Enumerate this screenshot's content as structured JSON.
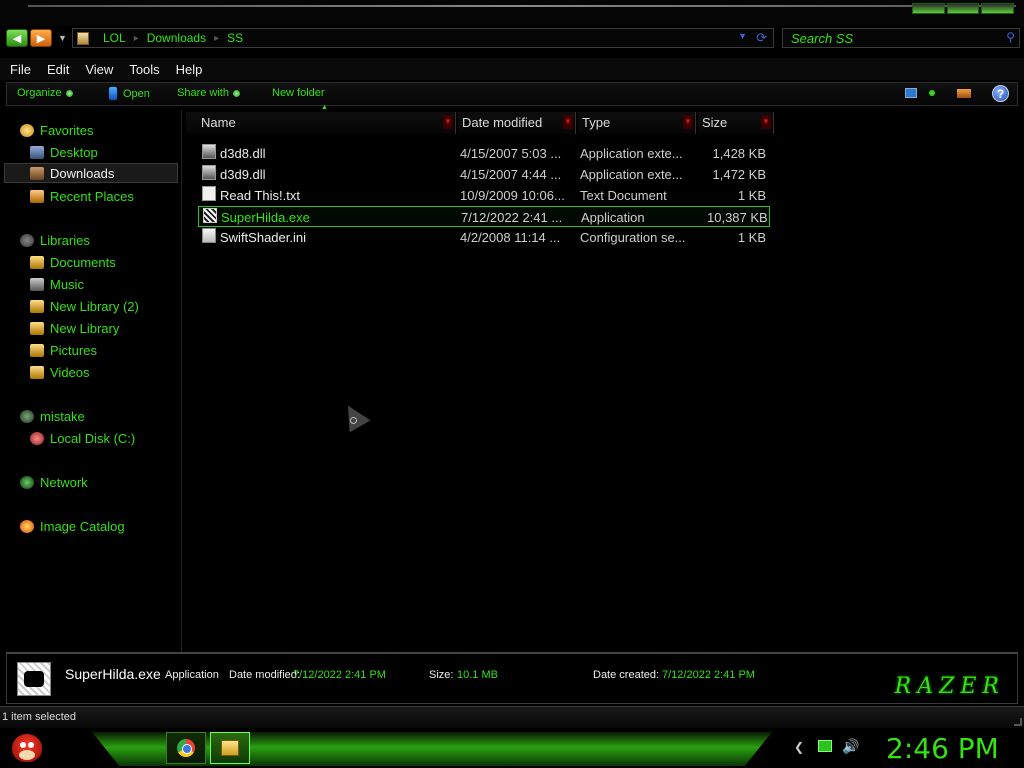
{
  "window": {
    "address_path": [
      "LOL",
      "Downloads",
      "SS"
    ],
    "search_placeholder": "Search SS"
  },
  "menu": [
    "File",
    "Edit",
    "View",
    "Tools",
    "Help"
  ],
  "command_bar": {
    "organize": "Organize",
    "open": "Open",
    "share_with": "Share with",
    "new_folder": "New folder"
  },
  "nav_pane": {
    "favorites": "Favorites",
    "desktop": "Desktop",
    "downloads": "Downloads",
    "recent_places": "Recent Places",
    "libraries": "Libraries",
    "documents": "Documents",
    "music": "Music",
    "new_library_2": "New Library (2)",
    "new_library": "New Library",
    "pictures": "Pictures",
    "videos": "Videos",
    "homegroup": "mistake",
    "local_disk": "Local Disk (C:)",
    "network": "Network",
    "image_catalog": "Image Catalog"
  },
  "columns": {
    "name": "Name",
    "date": "Date modified",
    "type": "Type",
    "size": "Size"
  },
  "files": [
    {
      "name": "d3d8.dll",
      "date": "4/15/2007 5:03 ...",
      "type": "Application exte...",
      "size": "1,428 KB"
    },
    {
      "name": "d3d9.dll",
      "date": "4/15/2007 4:44 ...",
      "type": "Application exte...",
      "size": "1,472 KB"
    },
    {
      "name": "Read This!.txt",
      "date": "10/9/2009 10:06...",
      "type": "Text Document",
      "size": "1 KB"
    },
    {
      "name": "SuperHilda.exe",
      "date": "7/12/2022 2:41 ...",
      "type": "Application",
      "size": "10,387 KB"
    },
    {
      "name": "SwiftShader.ini",
      "date": "4/2/2008 11:14 ...",
      "type": "Configuration se...",
      "size": "1 KB"
    }
  ],
  "details": {
    "name": "SuperHilda.exe",
    "type": "Application",
    "date_modified_label": "Date modified:",
    "date_modified": "7/12/2022 2:41 PM",
    "size_label": "Size:",
    "size": "10.1 MB",
    "date_created_label": "Date created:",
    "date_created": "7/12/2022 2:41 PM",
    "brand": "RAZER"
  },
  "status": {
    "text": "1 item selected"
  },
  "taskbar": {
    "clock": "2:46 PM"
  },
  "colors": {
    "accent": "#35e015",
    "background": "#000000"
  }
}
